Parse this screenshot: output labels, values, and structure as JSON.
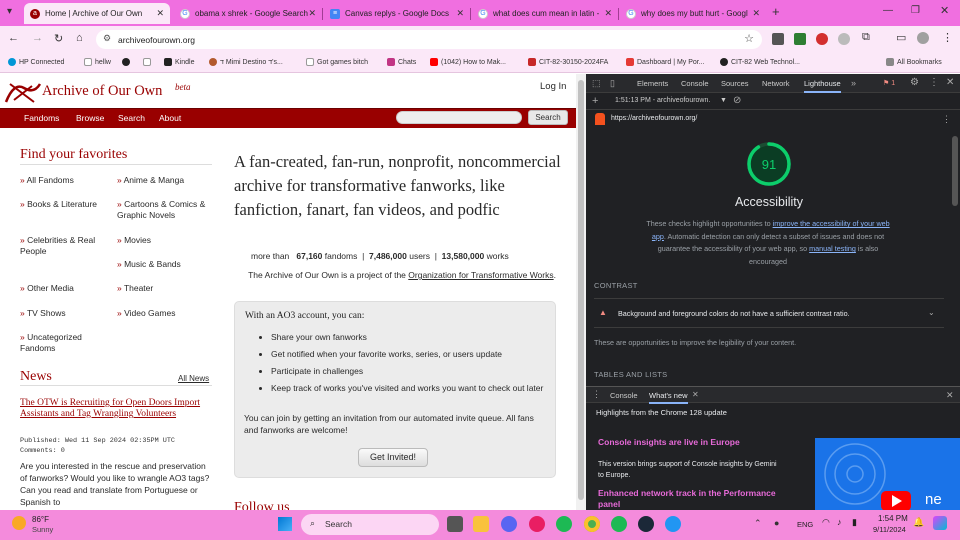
{
  "browser": {
    "tabs": [
      {
        "title": "Home | Archive of Our Own",
        "icon": "ao3-icon",
        "active": true
      },
      {
        "title": "obama x shrek - Google Search",
        "icon": "google-icon"
      },
      {
        "title": "Canvas replys - Google Docs",
        "icon": "docs-icon"
      },
      {
        "title": "what does cum mean in latin - ",
        "icon": "google-icon"
      },
      {
        "title": "why does my butt hurt - Googl",
        "icon": "google-icon"
      }
    ],
    "new_tab": "+",
    "url": "archiveofourown.org",
    "bookmarks": [
      "HP Connected",
      "hellw",
      "",
      "",
      "Kindle",
      "ﬢ Mimi Destino ﬢ's...",
      "Got games bitch",
      "Chats",
      "(1042) How to Mak...",
      "CIT-82-30150-2024FA",
      "Dashboard | My Por...",
      "CIT-82 Web Technol..."
    ],
    "all_bookmarks": "All Bookmarks",
    "colors": {
      "tabbar": "#f06fe0",
      "toolbar": "#fbe8f8"
    }
  },
  "ao3": {
    "logo_text": "Archive of Our Own",
    "logo_beta": "beta",
    "login": "Log In",
    "nav": [
      "Fandoms",
      "Browse",
      "Search",
      "About"
    ],
    "search_button": "Search",
    "favorites_heading": "Find your favorites",
    "favorites": [
      [
        "All Fandoms",
        "Anime & Manga"
      ],
      [
        "Books & Literature",
        "Cartoons & Comics & Graphic Novels"
      ],
      [
        "Celebrities & Real People",
        "Movies"
      ],
      [
        "",
        "Music & Bands"
      ],
      [
        "Other Media",
        "Theater"
      ],
      [
        "TV Shows",
        "Video Games"
      ],
      [
        "Uncategorized Fandoms",
        ""
      ]
    ],
    "news_heading": "News",
    "all_news": "All News",
    "news_title": "The OTW is Recruiting for Open Doors Import Assistants and Tag Wrangling Volunteers",
    "news_published": "Published: Wed 11 Sep 2024 02:35PM UTC",
    "news_comments": "Comments: 0",
    "news_body": "Are you interested in the rescue and preservation of fanworks? Would you like to wrangle AO3 tags? Can you read and translate from Portuguese or Spanish to",
    "tagline": "A fan-created, fan-run, nonprofit, noncommercial archive for transformative fanworks, like fanfiction, fanart, fan videos, and podfic",
    "stats_prefix": "more than",
    "stats": [
      {
        "value": "67,160",
        "label": "fandoms"
      },
      {
        "value": "7,486,000",
        "label": "users"
      },
      {
        "value": "13,580,000",
        "label": "works"
      }
    ],
    "project_text": "The Archive of Our Own is a project of the",
    "project_link": "Organization for Transformative Works",
    "account_heading": "With an AO3 account, you can:",
    "account_items": [
      "Share your own fanworks",
      "Get notified when your favorite works, series, or users update",
      "Participate in challenges",
      "Keep track of works you've visited and works you want to check out later"
    ],
    "invite_text": "You can join by getting an invitation from our automated invite queue. All fans and fanworks are welcome!",
    "invite_button": "Get Invited!",
    "follow_heading": "Follow us",
    "accent": "#990000"
  },
  "devtools": {
    "tabs": [
      "Elements",
      "Console",
      "Sources",
      "Network",
      "Lighthouse"
    ],
    "issues_count": "1",
    "report_time": "1:51:13 PM - archiveofourown.",
    "report_url": "https://archiveofourown.org/",
    "score": "91",
    "score_fraction": 0.91,
    "category": "Accessibility",
    "desc_1": "These checks highlight opportunities to ",
    "desc_link1": "improve the accessibility of your web app",
    "desc_2": ". Automatic detection can only detect a subset of issues and does not guarantee the accessibility of your web app, so ",
    "desc_link2": "manual testing",
    "desc_3": " is also encouraged",
    "contrast_heading": "CONTRAST",
    "contrast_issue": "Background and foreground colors do not have a sufficient contrast ratio.",
    "contrast_note": "These are opportunities to improve the legibility of your content.",
    "tables_heading": "TABLES AND LISTS",
    "drawer_tabs": [
      "Console",
      "What's new"
    ],
    "whatsnew_title": "Highlights from the Chrome 128 update",
    "insight1_title": "Console insights are live in Europe",
    "insight1_body": "This version brings support of Console insights by Gemini to Europe.",
    "insight2_title": "Enhanced network track in the Performance panel",
    "promo_text": "ne",
    "score_color": "#0cce6b"
  },
  "taskbar": {
    "weather_temp": "86°F",
    "weather_desc": "Sunny",
    "search": "Search",
    "lang": "ENG",
    "time": "1:54 PM",
    "date": "9/11/2024"
  }
}
